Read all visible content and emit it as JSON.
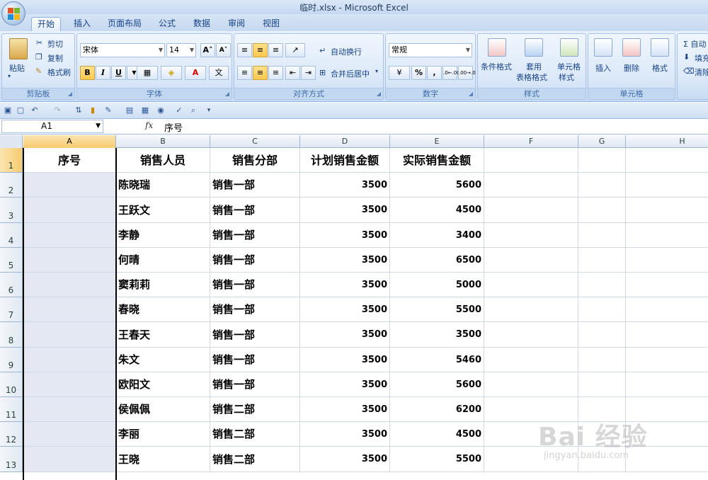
{
  "window": {
    "title": "临时.xlsx - Microsoft Excel"
  },
  "tabs": [
    "开始",
    "插入",
    "页面布局",
    "公式",
    "数据",
    "审阅",
    "视图"
  ],
  "ribbon": {
    "clipboard": {
      "label": "剪贴板",
      "paste": "粘贴",
      "cut": "剪切",
      "copy": "复制",
      "format_painter": "格式刷"
    },
    "font": {
      "label": "字体",
      "font_name": "宋体",
      "font_size": "14",
      "bold": "B",
      "italic": "I",
      "underline": "U",
      "grow": "A",
      "shrink": "A",
      "phonetic": "文"
    },
    "alignment": {
      "label": "对齐方式",
      "wrap_text": "自动换行",
      "merge_center": "合并后居中"
    },
    "number": {
      "label": "数字",
      "format": "常规",
      "percent": "%",
      "comma": ",",
      "inc_decimal": ".0←.00",
      "dec_decimal": ".00→.0"
    },
    "styles": {
      "label": "样式",
      "conditional": "条件格式",
      "table_format_1": "套用",
      "table_format_2": "表格格式",
      "cell_styles_1": "单元格",
      "cell_styles_2": "样式"
    },
    "cells": {
      "label": "单元格",
      "insert": "插入",
      "delete": "删除",
      "format": "格式"
    },
    "editing": {
      "sum": "Σ 自动",
      "fill": "填充",
      "clear": "清除"
    }
  },
  "formula_bar": {
    "name_box": "A1",
    "fx": "fx",
    "value": "序号"
  },
  "columns": [
    "A",
    "B",
    "C",
    "D",
    "E",
    "F",
    "G",
    "H"
  ],
  "rows": [
    "1",
    "2",
    "3",
    "4",
    "5",
    "6",
    "7",
    "8",
    "9",
    "10",
    "11",
    "12",
    "13"
  ],
  "table": {
    "headers": [
      "序号",
      "销售人员",
      "销售分部",
      "计划销售金额",
      "实际销售金额"
    ],
    "records": [
      [
        "陈晓瑞",
        "销售一部",
        "3500",
        "5600"
      ],
      [
        "王跃文",
        "销售一部",
        "3500",
        "4500"
      ],
      [
        "李静",
        "销售一部",
        "3500",
        "3400"
      ],
      [
        "何晴",
        "销售一部",
        "3500",
        "6500"
      ],
      [
        "窦莉莉",
        "销售一部",
        "3500",
        "5000"
      ],
      [
        "春晓",
        "销售一部",
        "3500",
        "5500"
      ],
      [
        "王春天",
        "销售一部",
        "3500",
        "3500"
      ],
      [
        "朱文",
        "销售一部",
        "3500",
        "5460"
      ],
      [
        "欧阳文",
        "销售一部",
        "3500",
        "5600"
      ],
      [
        "侯佩佩",
        "销售二部",
        "3500",
        "6200"
      ],
      [
        "李丽",
        "销售二部",
        "3500",
        "4500"
      ],
      [
        "王晓",
        "销售二部",
        "3500",
        "5500"
      ]
    ]
  },
  "watermark": {
    "text": "Bai 经验",
    "url": "jingyan.baidu.com"
  }
}
